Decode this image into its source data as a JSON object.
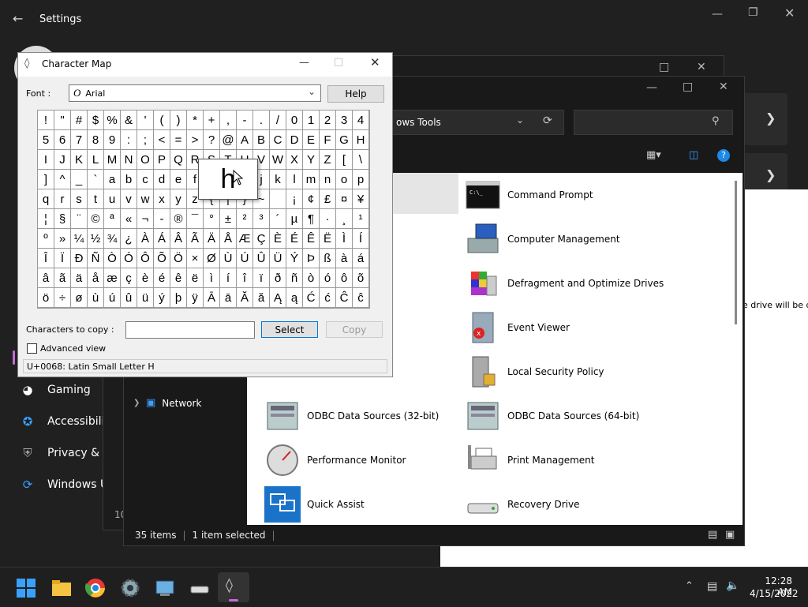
{
  "settings": {
    "title": "Settings",
    "nav": [
      {
        "label": "Gaming",
        "icon": "gamepad-icon"
      },
      {
        "label": "Accessibility",
        "icon": "accessibility-icon"
      },
      {
        "label": "Privacy & se",
        "icon": "shield-icon"
      },
      {
        "label": "Windows U",
        "icon": "update-icon"
      }
    ],
    "partial_text": "he drive will be d",
    "partial_count": "10"
  },
  "explorer": {
    "address": "ows Tools",
    "nav_network": "Network",
    "tools": [
      {
        "label": "Command Prompt",
        "icon": "command-prompt-icon"
      },
      {
        "label": "Computer Management",
        "icon": "computer-management-icon"
      },
      {
        "label": "Defragment and Optimize Drives",
        "icon": "defrag-icon"
      },
      {
        "label": "Event Viewer",
        "icon": "event-viewer-icon"
      },
      {
        "label": "Local Security Policy",
        "icon": "security-policy-icon"
      },
      {
        "label": "ODBC Data Sources (32-bit)",
        "icon": "odbc-icon"
      },
      {
        "label": "ODBC Data Sources (64-bit)",
        "icon": "odbc-icon"
      },
      {
        "label": "Performance Monitor",
        "icon": "performance-monitor-icon"
      },
      {
        "label": "Print Management",
        "icon": "print-management-icon"
      },
      {
        "label": "Quick Assist",
        "icon": "quick-assist-icon"
      },
      {
        "label": "Recovery Drive",
        "icon": "recovery-drive-icon"
      }
    ],
    "status_items": "35 items",
    "status_selected": "1 item selected"
  },
  "charmap": {
    "title": "Character Map",
    "font_label": "Font :",
    "font_value": "Arial",
    "help_label": "Help",
    "chars": [
      "!",
      "\"",
      "#",
      "$",
      "%",
      "&",
      "'",
      "(",
      ")",
      "*",
      "+",
      ",",
      "-",
      ".",
      "/",
      "0",
      "1",
      "2",
      "3",
      "4",
      "5",
      "6",
      "7",
      "8",
      "9",
      ":",
      ";",
      "<",
      "=",
      ">",
      "?",
      "@",
      "A",
      "B",
      "C",
      "D",
      "E",
      "F",
      "G",
      "H",
      "I",
      "J",
      "K",
      "L",
      "M",
      "N",
      "O",
      "P",
      "Q",
      "R",
      "S",
      "T",
      "U",
      "V",
      "W",
      "X",
      "Y",
      "Z",
      "[",
      "\\",
      "]",
      "^",
      "_",
      "`",
      "a",
      "b",
      "c",
      "d",
      "e",
      "f",
      "g",
      "h",
      "i",
      "j",
      "k",
      "l",
      "m",
      "n",
      "o",
      "p",
      "q",
      "r",
      "s",
      "t",
      "u",
      "v",
      "w",
      "x",
      "y",
      "z",
      "{",
      "|",
      "}",
      "~",
      " ",
      "¡",
      "¢",
      "£",
      "¤",
      "¥",
      "¦",
      "§",
      "¨",
      "©",
      "ª",
      "«",
      "¬",
      "-",
      "®",
      "¯",
      "°",
      "±",
      "²",
      "³",
      "´",
      "µ",
      "¶",
      "·",
      "¸",
      "¹",
      "º",
      "»",
      "¼",
      "½",
      "¾",
      "¿",
      "À",
      "Á",
      "Â",
      "Ã",
      "Ä",
      "Å",
      "Æ",
      "Ç",
      "È",
      "É",
      "Ê",
      "Ë",
      "Ì",
      "Í",
      "Î",
      "Ï",
      "Ð",
      "Ñ",
      "Ò",
      "Ó",
      "Ô",
      "Õ",
      "Ö",
      "×",
      "Ø",
      "Ù",
      "Ú",
      "Û",
      "Ü",
      "Ý",
      "Þ",
      "ß",
      "à",
      "á",
      "â",
      "ã",
      "ä",
      "å",
      "æ",
      "ç",
      "è",
      "é",
      "ê",
      "ë",
      "ì",
      "í",
      "î",
      "ï",
      "ð",
      "ñ",
      "ò",
      "ó",
      "ô",
      "õ",
      "ö",
      "÷",
      "ø",
      "ù",
      "ú",
      "û",
      "ü",
      "ý",
      "þ",
      "ÿ",
      "Ā",
      "ā",
      "Ă",
      "ă",
      "Ą",
      "ą",
      "Ć",
      "ć",
      "Ĉ",
      "ĉ"
    ],
    "zoom_char": "h",
    "copy_label": "Characters to copy :",
    "copy_value": "",
    "select_label": "Select",
    "copy_button": "Copy",
    "advanced_label": "Advanced view",
    "status": "U+0068: Latin Small Letter H"
  },
  "taskbar": {
    "time": "12:28 AM",
    "date": "4/15/2022"
  }
}
